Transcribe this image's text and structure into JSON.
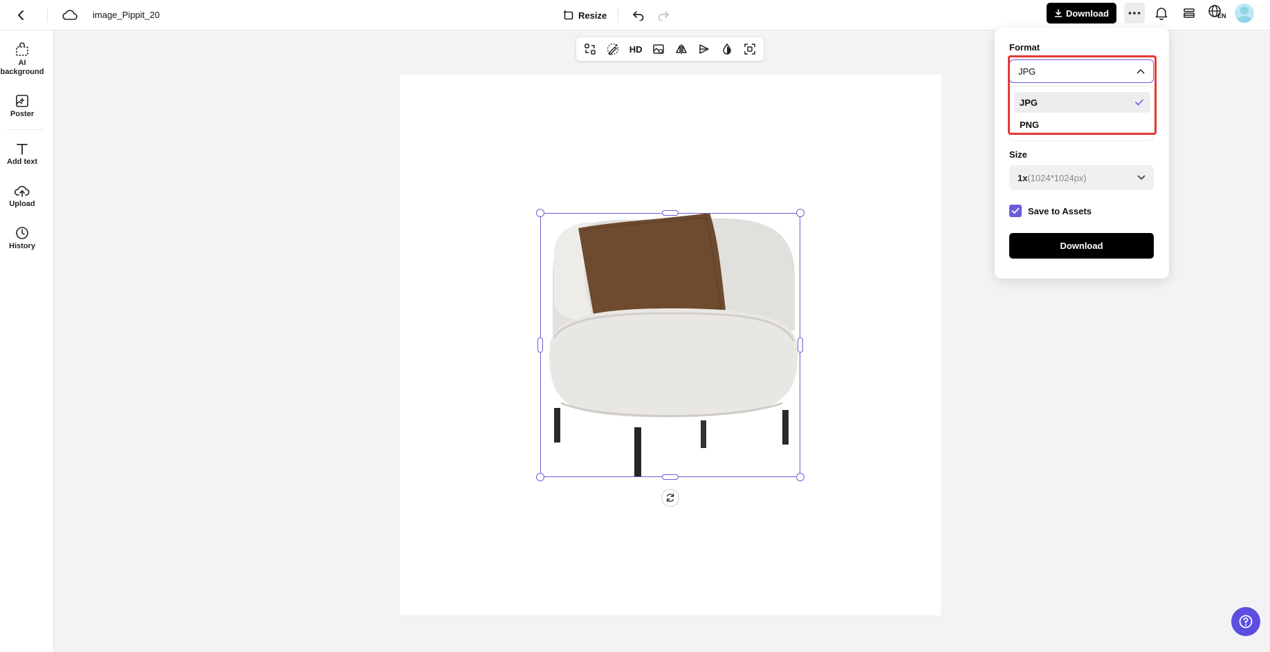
{
  "header": {
    "file_name": "image_Pippit_20",
    "resize_label": "Resize",
    "download_label": "Download",
    "language_code": "EN"
  },
  "sidebar": {
    "items": [
      {
        "label": "AI background",
        "icon": "ai-background-icon"
      },
      {
        "label": "Poster",
        "icon": "poster-icon"
      },
      {
        "label": "Add text",
        "icon": "text-icon"
      },
      {
        "label": "Upload",
        "icon": "upload-icon"
      },
      {
        "label": "History",
        "icon": "history-icon"
      }
    ]
  },
  "floating_toolbar": {
    "tools": [
      "replace-icon",
      "retouch-icon",
      "HD",
      "image-edit-icon",
      "flip-icon",
      "send-icon",
      "color-drop-icon",
      "focus-icon"
    ],
    "hd_label": "HD"
  },
  "canvas": {
    "image_subject": "armchair with brown pillow",
    "colors": {
      "selection": "#6b5cdc",
      "chair": "#e9e7e3",
      "pillow": "#6e4a2e",
      "legs": "#2a2a2a"
    }
  },
  "download_panel": {
    "format_label": "Format",
    "format_value": "JPG",
    "format_options": [
      {
        "label": "JPG",
        "selected": true
      },
      {
        "label": "PNG",
        "selected": false
      }
    ],
    "size_label": "Size",
    "size_value_main": "1x",
    "size_value_sub": "(1024*1024px)",
    "save_to_assets_label": "Save to Assets",
    "save_to_assets_checked": true,
    "download_button_label": "Download",
    "highlight_color": "#e53935"
  },
  "colors": {
    "accent": "#6b5cdc",
    "help_button": "#5b4ee0"
  }
}
